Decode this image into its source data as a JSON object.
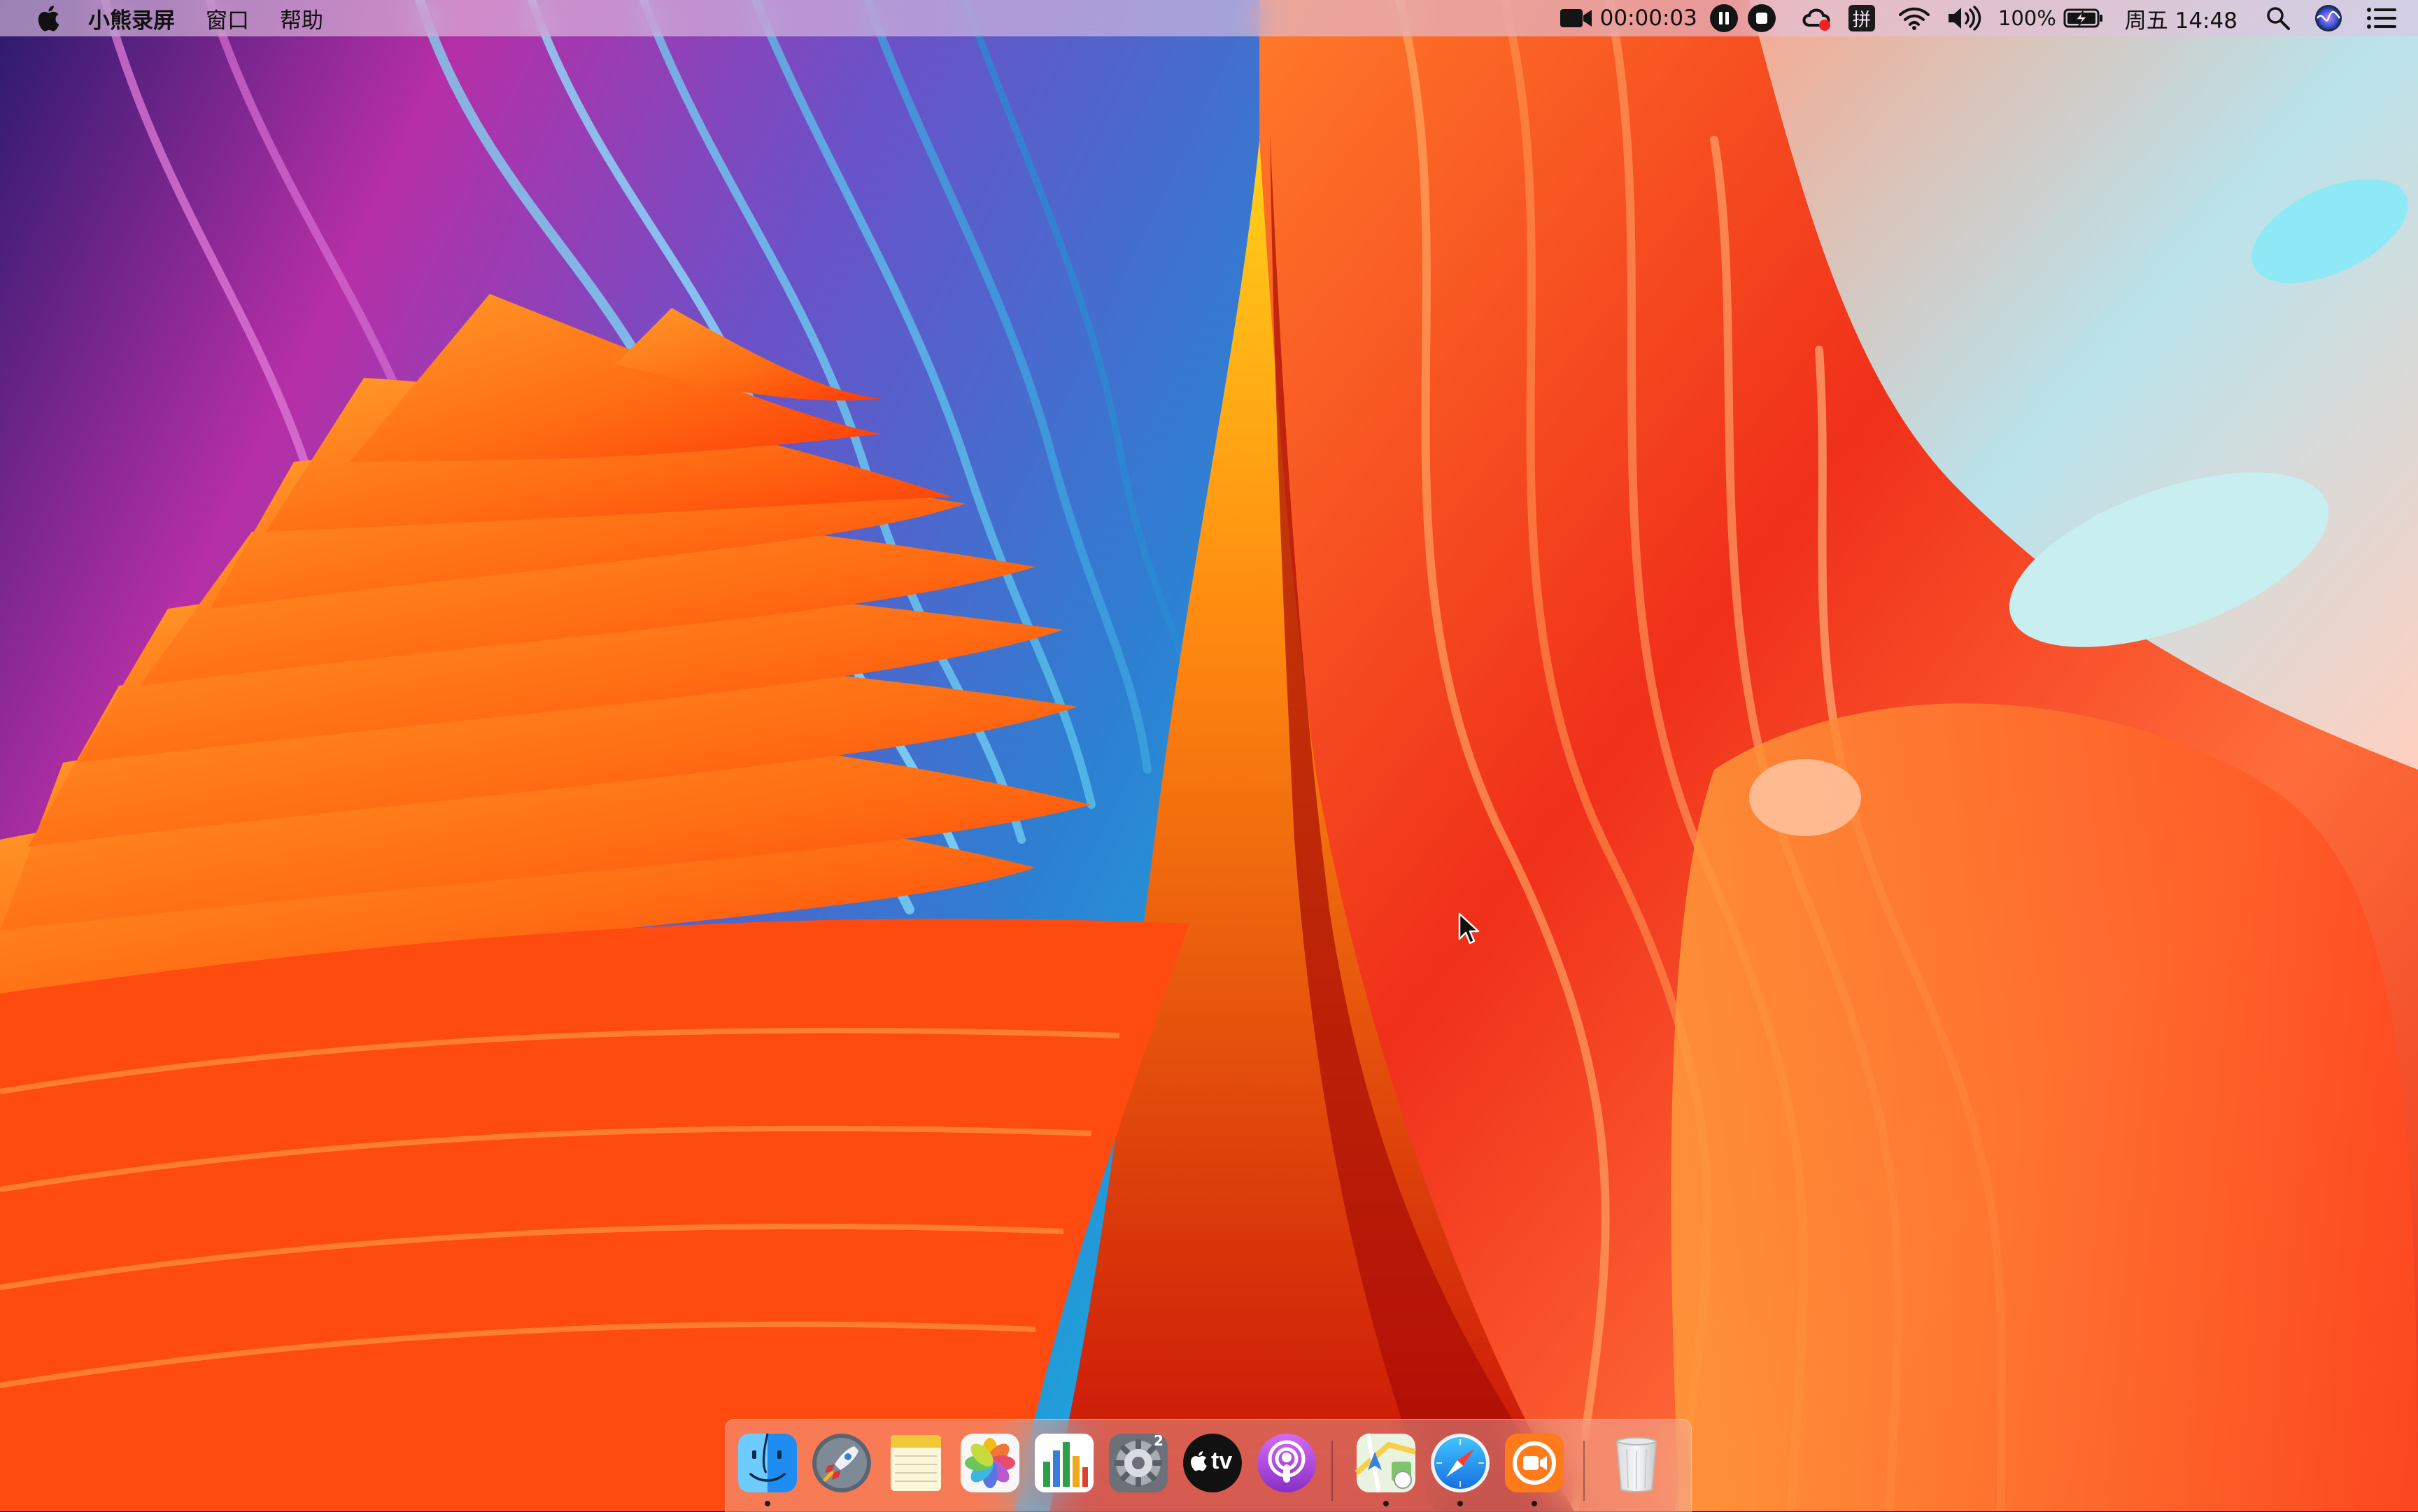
{
  "menubar": {
    "app_name": "小熊录屏",
    "menus": [
      "窗口",
      "帮助"
    ],
    "recording_time": "00:00:03",
    "battery_percent": "100%",
    "clock": "周五 14:48",
    "ime_label": "拼",
    "status_icons": [
      "video-camera-icon",
      "pause-icon",
      "stop-icon",
      "creative-cloud-icon",
      "input-method-icon",
      "wifi-icon",
      "volume-icon",
      "battery-charging-icon",
      "spotlight-search-icon",
      "siri-icon",
      "notification-center-icon"
    ]
  },
  "dock": {
    "apps": [
      {
        "name": "Finder",
        "icon": "finder-icon",
        "running": true
      },
      {
        "name": "Launchpad",
        "icon": "launchpad-icon",
        "running": false
      },
      {
        "name": "Notes",
        "icon": "notes-icon",
        "running": false
      },
      {
        "name": "Photos",
        "icon": "photos-icon",
        "running": false
      },
      {
        "name": "Numbers",
        "icon": "numbers-icon",
        "running": false
      },
      {
        "name": "System Preferences",
        "icon": "system-preferences-icon",
        "running": false,
        "badge": "2"
      },
      {
        "name": "Apple TV",
        "icon": "apple-tv-icon",
        "running": false,
        "label": "tv"
      },
      {
        "name": "Podcasts",
        "icon": "podcasts-icon",
        "running": false
      },
      {
        "name": "Maps",
        "icon": "maps-icon",
        "running": true
      },
      {
        "name": "Safari",
        "icon": "safari-icon",
        "running": true
      },
      {
        "name": "Screen Recorder",
        "icon": "screen-recorder-icon",
        "running": true
      },
      {
        "name": "Trash",
        "icon": "trash-icon",
        "running": false
      }
    ]
  },
  "colors": {
    "menubar_bg": "#e1c4e1",
    "wallpaper_orange": "#ff6a12",
    "wallpaper_red": "#e81e10",
    "wallpaper_blue": "#1f8fd8",
    "wallpaper_purple": "#9a2fb0"
  }
}
